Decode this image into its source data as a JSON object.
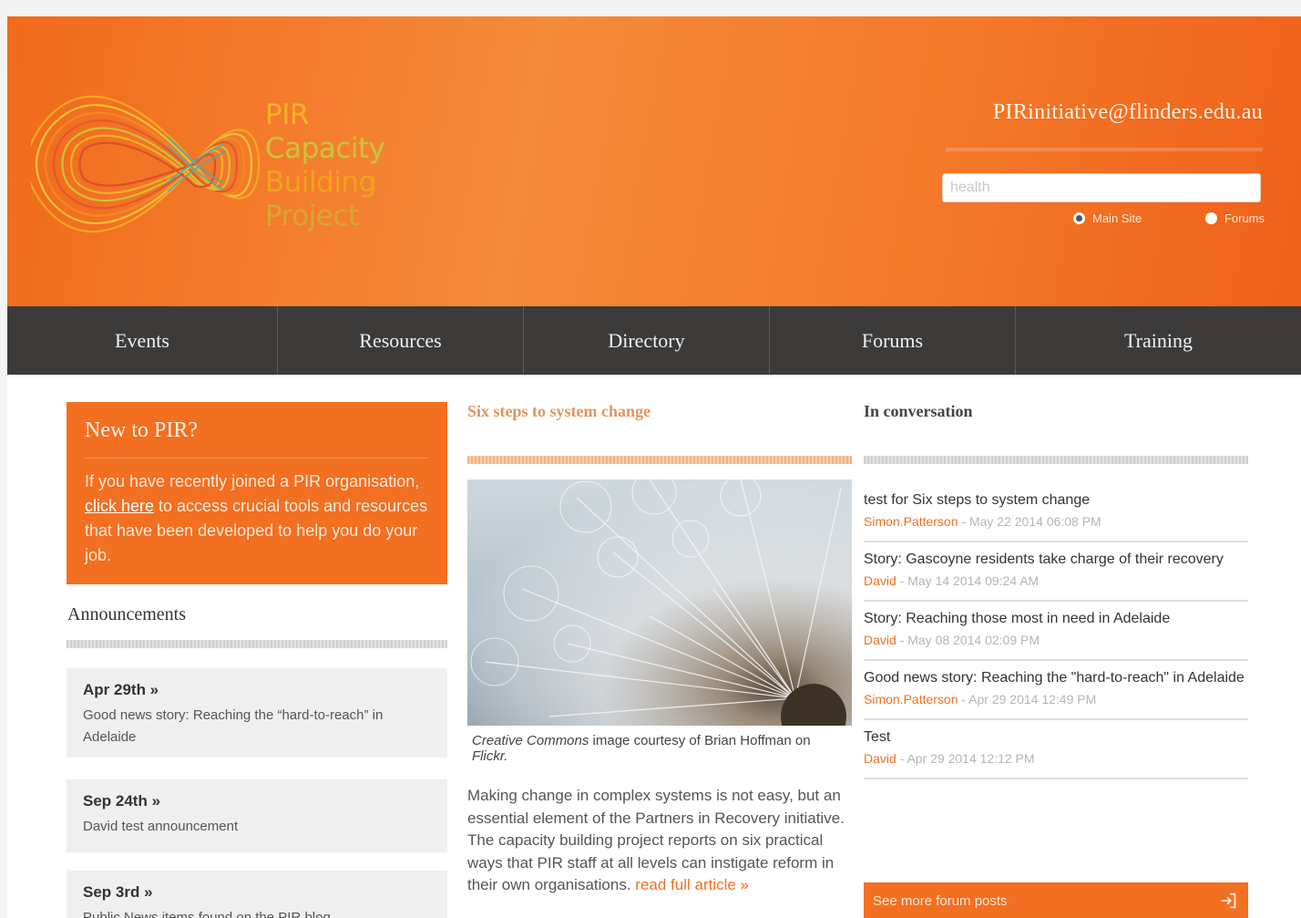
{
  "header": {
    "logo": {
      "line1": "PIR",
      "line2": "Capacity",
      "line3": "Building",
      "line4": "Project"
    },
    "email": "PIRinitiative@flinders.edu.au",
    "search": {
      "value": "",
      "placeholder": "health"
    },
    "scope": [
      {
        "label": "Main Site",
        "checked": true
      },
      {
        "label": "Forums",
        "checked": false
      }
    ]
  },
  "nav": [
    {
      "label": "Events"
    },
    {
      "label": "Resources"
    },
    {
      "label": "Directory"
    },
    {
      "label": "Forums"
    },
    {
      "label": "Training"
    }
  ],
  "new_box": {
    "title": "New to PIR?",
    "text_before": "If you have recently joined a PIR organisation, ",
    "link": "click here",
    "text_after": " to access crucial tools and resources that have been developed to help you do your job."
  },
  "announcements": {
    "title": "Announcements",
    "items": [
      {
        "date": "Apr 29th »",
        "text": "Good news story: Reaching the “hard-to-reach” in Adelaide"
      },
      {
        "date": "Sep 24th »",
        "text": "David test announcement"
      },
      {
        "date": "Sep 3rd »",
        "text": "Public News items found on the PIR blog"
      }
    ]
  },
  "feature": {
    "title": "Six steps to system change",
    "caption_italic1": "Creative Commons",
    "caption_mid": " image courtesy of Brian Hoffman on ",
    "caption_italic2": "Flickr.",
    "body": "Making change in complex systems is not easy, but an essential element of the Partners in Recovery initiative. The capacity building project reports on six practical ways that PIR staff at all levels can instigate reform in their own organisations.",
    "read_more": "read full article »"
  },
  "conversation": {
    "title": "In conversation",
    "items": [
      {
        "title": "test for Six steps to system change",
        "author": "Simon.Patterson",
        "meta": " - May 22 2014 06:08 PM"
      },
      {
        "title": "Story: Gascoyne residents take charge of their recovery",
        "author": "David",
        "meta": " - May 14 2014 09:24 AM"
      },
      {
        "title": "Story: Reaching those most in need in Adelaide",
        "author": "David",
        "meta": " - May 08 2014 02:09 PM"
      },
      {
        "title": "Good news story: Reaching the \"hard-to-reach\" in Adelaide",
        "author": "Simon.Patterson",
        "meta": " - Apr 29 2014 12:49 PM"
      },
      {
        "title": "Test",
        "author": "David",
        "meta": " - Apr 29 2014 12:12 PM"
      }
    ],
    "more_label": "See more forum posts"
  },
  "colors": {
    "accent": "#f36f21",
    "nav_bg": "#3c3b3a",
    "card_bg": "#efefef"
  }
}
